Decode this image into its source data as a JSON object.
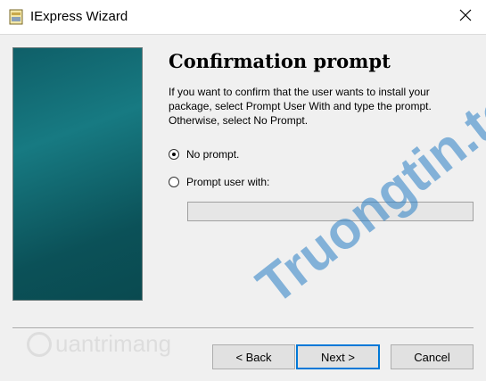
{
  "window": {
    "title": "IExpress Wizard",
    "close_glyph": "✕"
  },
  "page": {
    "heading": "Confirmation prompt",
    "description": "If you want to confirm that the user wants to install your package, select Prompt User With and type the prompt. Otherwise, select No Prompt."
  },
  "options": {
    "no_prompt": {
      "label": "No prompt.",
      "checked": true
    },
    "prompt_user": {
      "label": "Prompt user with:",
      "checked": false
    },
    "prompt_text": ""
  },
  "buttons": {
    "back": "< Back",
    "next": "Next >",
    "cancel": "Cancel"
  },
  "watermarks": {
    "left": "uantrimang",
    "right": "Truongtin.top"
  },
  "colors": {
    "banner": "#177a82",
    "accent": "#0078d7"
  }
}
